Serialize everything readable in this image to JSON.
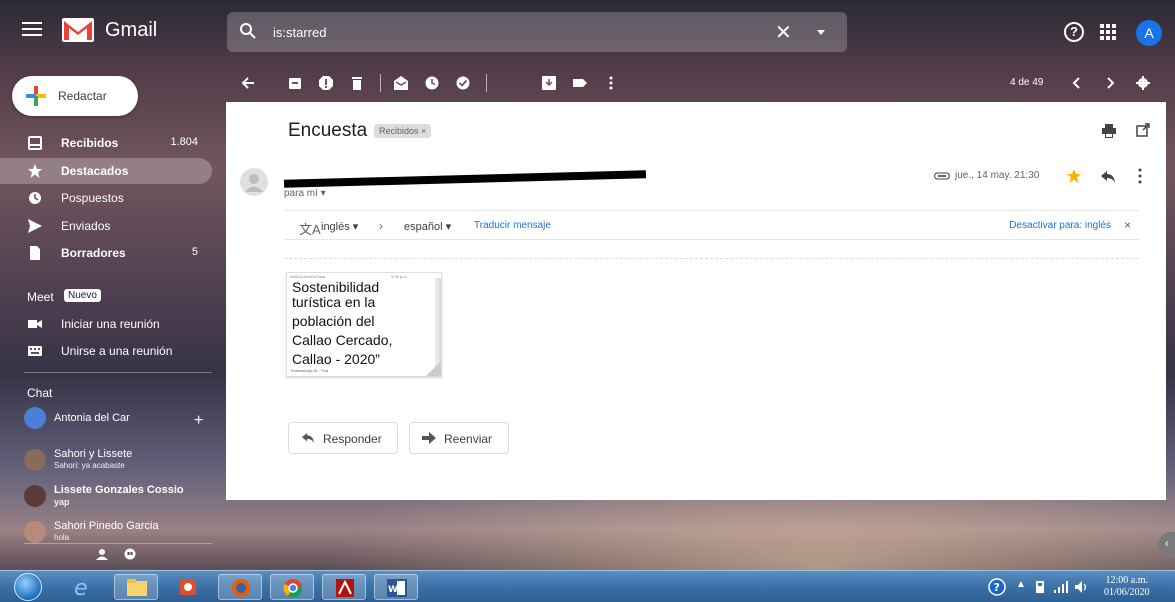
{
  "header": {
    "app_name": "Gmail",
    "search_value": "is:starred",
    "avatar_letter": "A"
  },
  "compose": {
    "label": "Redactar"
  },
  "sidebar": {
    "items": [
      {
        "label": "Recibidos",
        "count": "1.804",
        "bold": true,
        "icon": "inbox-icon"
      },
      {
        "label": "Destacados",
        "count": "",
        "bold": true,
        "icon": "star-icon",
        "active": true
      },
      {
        "label": "Pospuestos",
        "count": "",
        "icon": "clock-icon"
      },
      {
        "label": "Enviados",
        "count": "",
        "icon": "send-icon"
      },
      {
        "label": "Borradores",
        "count": "5",
        "bold": true,
        "icon": "draft-icon"
      }
    ],
    "meet": {
      "title": "Meet",
      "badge": "Nuevo",
      "items": [
        {
          "label": "Iniciar una reunión",
          "icon": "video-icon"
        },
        {
          "label": "Unirse a una reunión",
          "icon": "keyboard-icon"
        }
      ]
    },
    "chat": {
      "title": "Chat",
      "me": "Antonia del Car",
      "contacts": [
        {
          "name": "Sahori y Lissete",
          "snippet": "Sahori: ya acabaste"
        },
        {
          "name": "Lissete Gonzales Cossio",
          "snippet": "yap"
        },
        {
          "name": "Sahori Pinedo Garcia",
          "snippet": "hola"
        }
      ]
    }
  },
  "toolbar": {
    "pager": "4 de 49"
  },
  "message": {
    "subject": "Encuesta",
    "label": "Recibidos ×",
    "to": "para mí ▾",
    "date": "jue., 14 may. 21:30",
    "translate": {
      "from": "inglés ▾",
      "to": "español ▾",
      "link": "Traducir mensaje",
      "off": "Desactivar para: inglés"
    },
    "attachment": {
      "status_left": "YoMeQuedoEnCasa",
      "status_right": "9:39 p.m.",
      "lines": [
        "Sostenibilidad",
        "turística en la",
        "población del",
        "Callao Cercado,",
        "Callao - 2020”"
      ],
      "footer": "Estimado(a) Sr. / Sra."
    },
    "reply_label": "Responder",
    "forward_label": "Reenviar"
  },
  "taskbar": {
    "time": "12:00 a.m.",
    "date": "01/06/2020"
  },
  "colors": {
    "accent_blue": "#1a73e8",
    "star_yellow": "#f4b400",
    "gmail_red": "#ea4335"
  }
}
